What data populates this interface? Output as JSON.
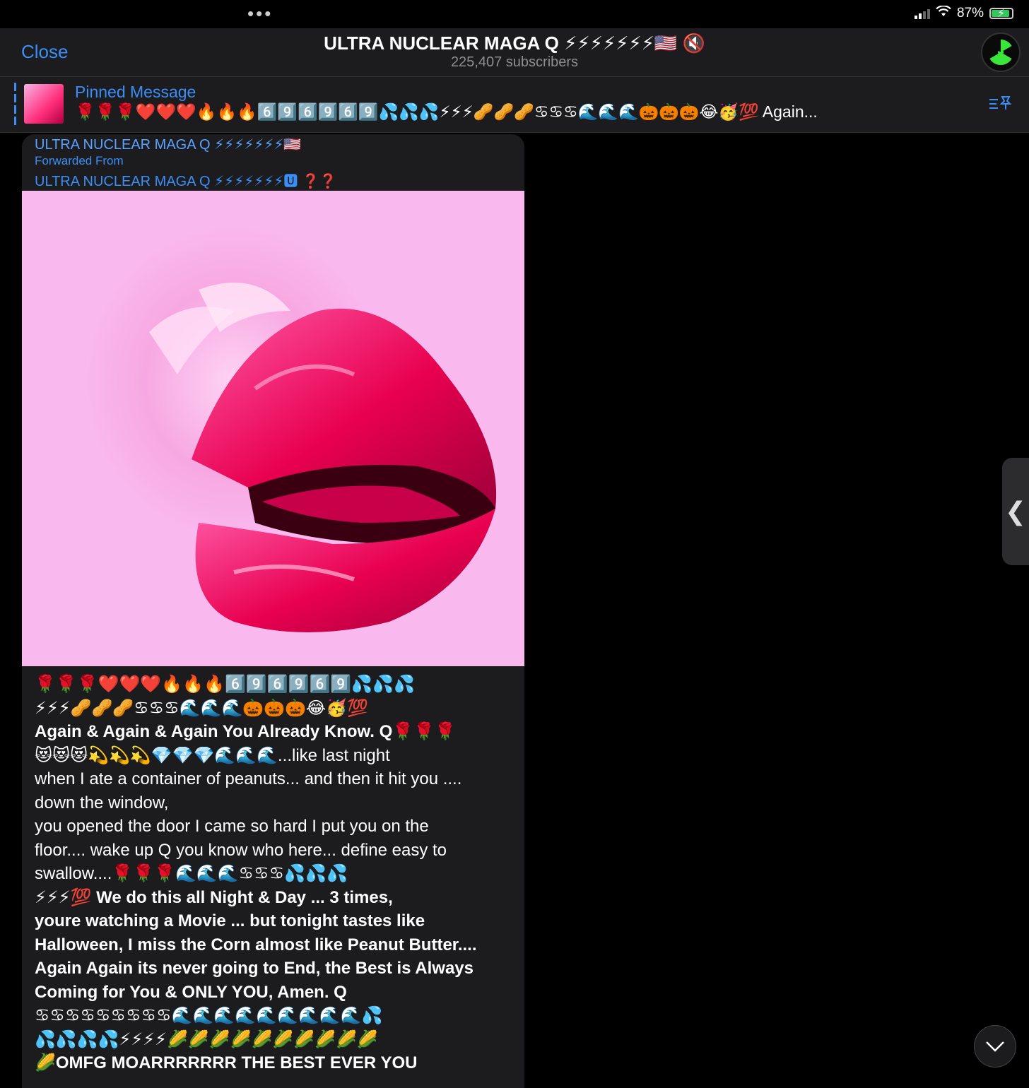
{
  "status": {
    "battery": "87%"
  },
  "header": {
    "close_label": "Close",
    "title": "ULTRA NUCLEAR MAGA Q ⚡⚡⚡⚡⚡⚡⚡🇺🇸 🔇",
    "subscribers": "225,407 subscribers"
  },
  "pinned": {
    "title": "Pinned Message",
    "text": "🌹🌹🌹❤️❤️❤️🔥🔥🔥6️⃣9️⃣6️⃣9️⃣6️⃣9️⃣💦💦💦⚡⚡⚡🥜🥜🥜♋♋♋🌊🌊🌊🎃🎃🎃😂🥳💯 Again..."
  },
  "message": {
    "sender": "ULTRA NUCLEAR MAGA Q ⚡⚡⚡⚡⚡⚡⚡🇺🇸",
    "forwarded_label": "Forwarded From",
    "forwarded_from": "ULTRA NUCLEAR MAGA Q ⚡⚡⚡⚡⚡⚡⚡🆄 ❓❓",
    "lines": [
      "🌹🌹🌹❤️❤️❤️🔥🔥🔥6️⃣9️⃣6️⃣9️⃣6️⃣9️⃣💦💦💦",
      "⚡⚡⚡🥜🥜🥜♋♋♋🌊🌊🌊🎃🎃🎃😂🥳💯",
      "Again & Again & Again You Already Know. Q🌹🌹🌹",
      "😻😻😻💫💫💫💎💎💎🌊🌊🌊...like last night",
      "when I ate a container of peanuts... and then it hit you ....",
      "down the window,",
      "you opened the door I came so hard I put you on the",
      "floor.... wake up Q you know who here... define easy to",
      "swallow....🌹🌹🌹🌊🌊🌊♋♋♋💦💦💦",
      "⚡⚡⚡💯 We do this all Night & Day ... 3 times,",
      "youre watching a Movie ... but tonight tastes like",
      "Halloween, I miss the Corn almost like Peanut Butter....",
      "Again Again its never going to End, the Best is Always",
      "Coming for You & ONLY YOU, Amen. Q",
      "♋♋♋♋♋♋♋♋♋🌊🌊🌊🌊🌊🌊🌊🌊🌊💦",
      "💦💦💦💦⚡⚡⚡⚡🌽🌽🌽🌽🌽🌽🌽🌽🌽🌽",
      "🌽OMFG MOARRRRRRR THE BEST EVER YOU"
    ]
  }
}
